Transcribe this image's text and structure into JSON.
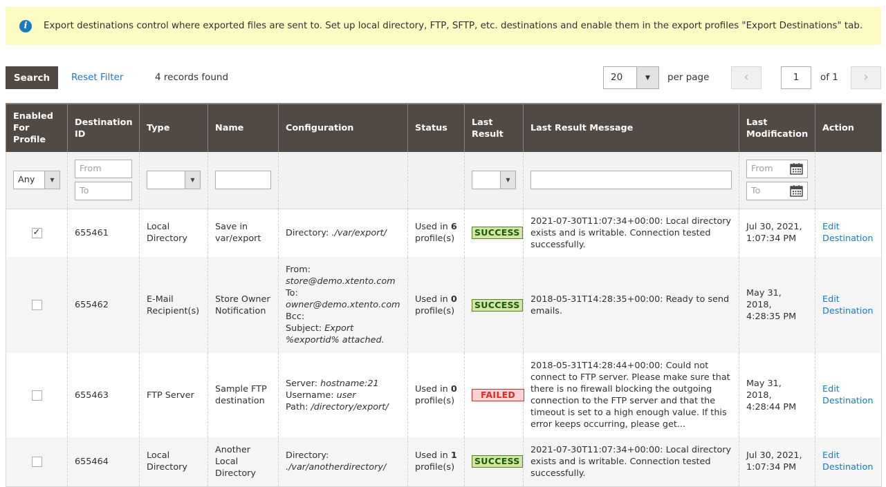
{
  "notice": {
    "icon": "info-icon",
    "text": "Export destinations control where exported files are sent to. Set up local directory, FTP, SFTP, etc. destinations and enable them in the export profiles \"Export Destinations\" tab."
  },
  "toolbar": {
    "search_label": "Search",
    "reset_label": "Reset Filter",
    "records_found": "4 records found",
    "per_page_value": "20",
    "per_page_label": "per page",
    "prev_icon": "‹",
    "next_icon": "›",
    "current_page": "1",
    "of_pages": "of 1"
  },
  "columns": [
    "Enabled For Profile",
    "Destination ID",
    "Type",
    "Name",
    "Configuration",
    "Status",
    "Last Result",
    "Last Result Message",
    "Last Modification",
    "Action"
  ],
  "filters": {
    "enabled_value": "Any",
    "id_from_placeholder": "From",
    "id_to_placeholder": "To",
    "type_value": "",
    "name_value": "",
    "last_result_value": "",
    "message_value": "",
    "date_from_placeholder": "From",
    "date_to_placeholder": "To"
  },
  "colors": {
    "header_bg": "#514943",
    "link": "#1979c3",
    "notice_bg": "#fdfbc4",
    "success_bg": "#d0e5a9",
    "success_text": "#185b00",
    "failed_bg": "#f9d4d4",
    "failed_text": "#e22626"
  },
  "rows": [
    {
      "enabled": true,
      "id": "655461",
      "type": "Local Directory",
      "name": "Save in var/export",
      "config": [
        {
          "label": "Directory: ",
          "value": "./var/export/"
        }
      ],
      "status_prefix": "Used in ",
      "status_count": "6",
      "status_suffix": " profile(s)",
      "last_result": "SUCCESS",
      "message": "2021-07-30T11:07:34+00:00: Local directory exists and is writable. Connection tested successfully.",
      "modified": "Jul 30, 2021, 1:07:34 PM",
      "action": "Edit Destination"
    },
    {
      "enabled": false,
      "id": "655462",
      "type": "E-Mail Recipient(s)",
      "name": "Store Owner Notification",
      "config": [
        {
          "label": "From: ",
          "value": "store@demo.xtento.com"
        },
        {
          "label": "To: ",
          "value": "owner@demo.xtento.com"
        },
        {
          "label": "Bcc: ",
          "value": ""
        },
        {
          "label": "Subject: ",
          "value": "Export %exportid% attached."
        }
      ],
      "status_prefix": "Used in ",
      "status_count": "0",
      "status_suffix": " profile(s)",
      "last_result": "SUCCESS",
      "message": "2018-05-31T14:28:35+00:00: Ready to send emails.",
      "modified": "May 31, 2018, 4:28:35 PM",
      "action": "Edit Destination"
    },
    {
      "enabled": false,
      "id": "655463",
      "type": "FTP Server",
      "name": "Sample FTP destination",
      "config": [
        {
          "label": "Server: ",
          "value": "hostname:21"
        },
        {
          "label": "Username: ",
          "value": "user"
        },
        {
          "label": "Path: ",
          "value": "/directory/export/"
        }
      ],
      "status_prefix": "Used in ",
      "status_count": "0",
      "status_suffix": " profile(s)",
      "last_result": "FAILED",
      "message": "2018-05-31T14:28:44+00:00: Could not connect to FTP server. Please make sure that there is no firewall blocking the outgoing connection to the FTP server and that the timeout is set to a high enough value. If this error keeps occurring, please get...",
      "modified": "May 31, 2018, 4:28:44 PM",
      "action": "Edit Destination"
    },
    {
      "enabled": false,
      "id": "655464",
      "type": "Local Directory",
      "name": "Another Local Directory",
      "config": [
        {
          "label": "Directory: ",
          "value": "./var/anotherdirectory/"
        }
      ],
      "status_prefix": "Used in ",
      "status_count": "1",
      "status_suffix": " profile(s)",
      "last_result": "SUCCESS",
      "message": "2021-07-30T11:07:34+00:00: Local directory exists and is writable. Connection tested successfully.",
      "modified": "Jul 30, 2021, 1:07:34 PM",
      "action": "Edit Destination"
    }
  ]
}
